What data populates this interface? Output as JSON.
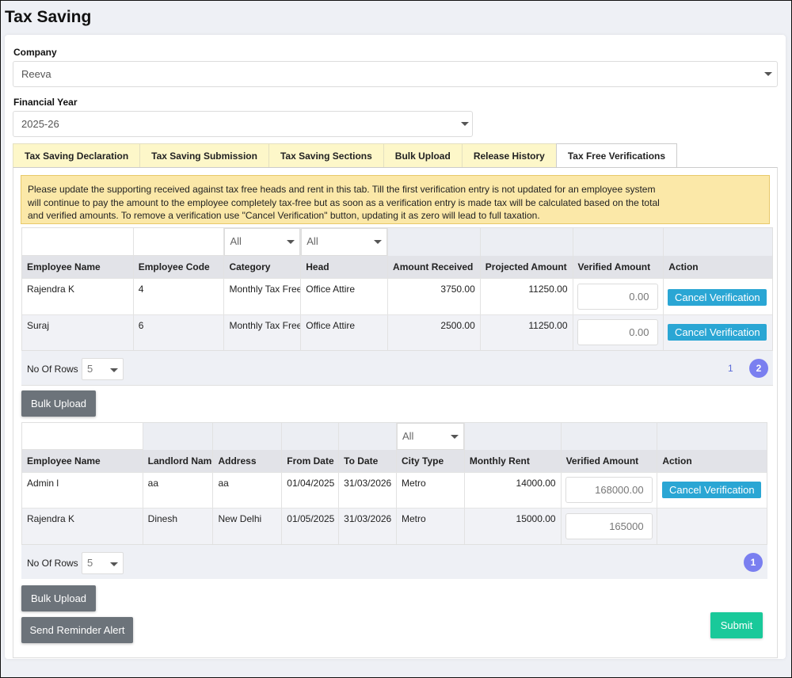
{
  "page": {
    "title": "Tax Saving"
  },
  "filters": {
    "company_label": "Company",
    "company_value": "Reeva",
    "financial_year_label": "Financial Year",
    "financial_year_value": "2025-26"
  },
  "tabs": [
    {
      "label": "Tax Saving Declaration",
      "active": false
    },
    {
      "label": "Tax Saving Submission",
      "active": false
    },
    {
      "label": "Tax Saving Sections",
      "active": false
    },
    {
      "label": "Bulk Upload",
      "active": false
    },
    {
      "label": "Release History",
      "active": false
    },
    {
      "label": "Tax Free Verifications",
      "active": true
    }
  ],
  "notice": "Please update the supporting received against tax free heads and rent in this tab. Till the first verification entry is not updated for an employee system will continue to pay the amount to the employee completely tax-free but as soon as a verification entry is made tax will be calculated based on the total and verified amounts. To remove a verification use \"Cancel Verification\" button, updating it as zero will lead to full taxation.",
  "heads_grid": {
    "filters": {
      "category": "All",
      "head": "All"
    },
    "columns": [
      "Employee Name",
      "Employee Code",
      "Category",
      "Head",
      "Amount Received",
      "Projected Amount",
      "Verified Amount",
      "Action"
    ],
    "rows": [
      {
        "employee_name": "Rajendra K",
        "employee_code": "4",
        "category": "Monthly Tax Free",
        "head": "Office Attire",
        "amount_received": "3750.00",
        "projected_amount": "11250.00",
        "verified_amount": "0.00",
        "action": "Cancel Verification"
      },
      {
        "employee_name": "Suraj",
        "employee_code": "6",
        "category": "Monthly Tax Free",
        "head": "Office Attire",
        "amount_received": "2500.00",
        "projected_amount": "11250.00",
        "verified_amount": "0.00",
        "action": "Cancel Verification"
      }
    ],
    "rows_label": "No Of Rows :",
    "rows_value": "5",
    "pages": [
      "1",
      "2"
    ],
    "current_page": "2"
  },
  "heads_bulk_upload": "Bulk Upload",
  "rent_grid": {
    "filters": {
      "city_type": "All"
    },
    "columns": [
      "Employee Name",
      "Landlord Name",
      "Address",
      "From Date",
      "To Date",
      "City Type",
      "Monthly Rent",
      "Verified Amount",
      "Action"
    ],
    "rows": [
      {
        "employee_name": "Admin l",
        "landlord_name": "aa",
        "address": "aa",
        "from_date": "01/04/2025",
        "to_date": "31/03/2026",
        "city_type": "Metro",
        "monthly_rent": "14000.00",
        "verified_amount": "168000.00",
        "action": "Cancel Verification"
      },
      {
        "employee_name": "Rajendra K",
        "landlord_name": "Dinesh",
        "address": "New Delhi",
        "from_date": "01/05/2025",
        "to_date": "31/03/2026",
        "city_type": "Metro",
        "monthly_rent": "15000.00",
        "verified_amount": "165000",
        "action": ""
      }
    ],
    "rows_label": "No Of Rows :",
    "rows_value": "5",
    "current_page": "1"
  },
  "rent_bulk_upload": "Bulk Upload",
  "send_reminder": "Send Reminder Alert",
  "submit": "Submit"
}
